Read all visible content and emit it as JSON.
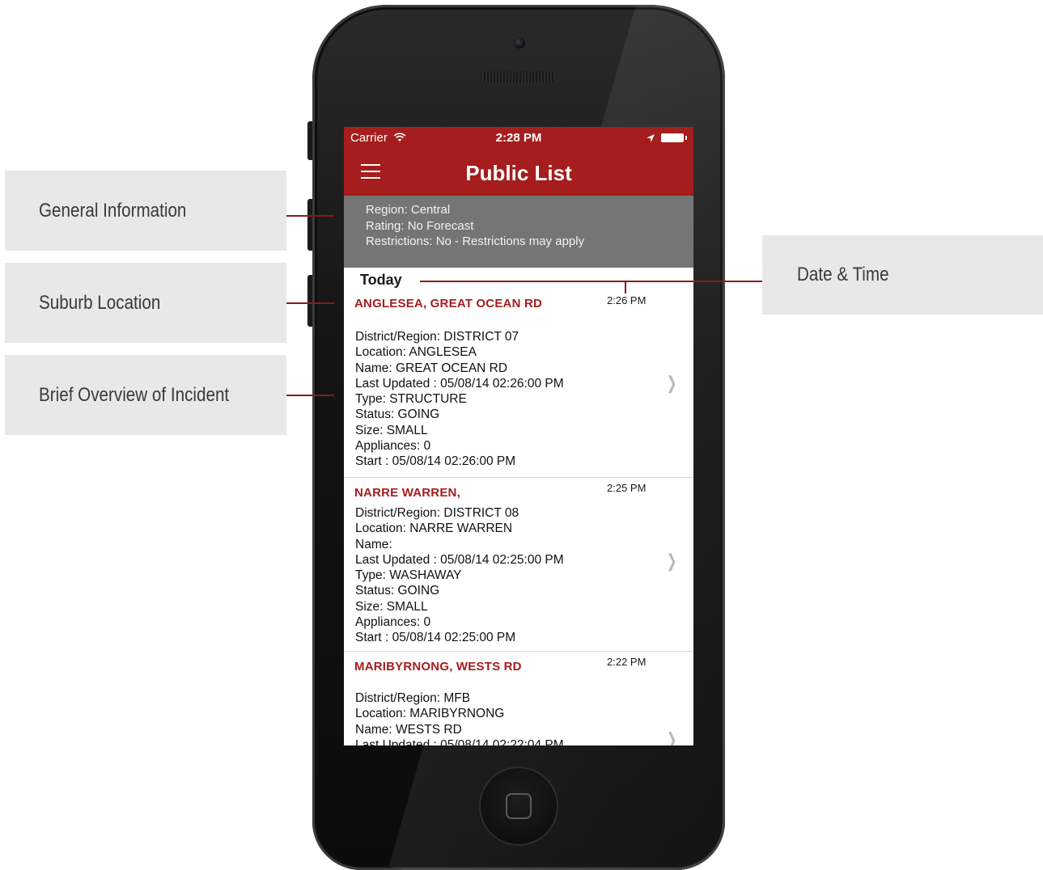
{
  "callouts": {
    "general_info": "General Information",
    "suburb_location": "Suburb Location",
    "brief_overview": "Brief Overview of Incident",
    "date_time": "Date & Time"
  },
  "status_bar": {
    "carrier": "Carrier",
    "time": "2:28 PM"
  },
  "nav": {
    "title": "Public List"
  },
  "info": {
    "region": "Region: Central",
    "rating": "Rating:  No Forecast",
    "restrictions": "Restrictions:  No - Restrictions may apply"
  },
  "section": {
    "label": "Today"
  },
  "incidents": [
    {
      "place": "ANGLESEA, GREAT OCEAN RD",
      "time": "2:26 PM",
      "lines": [
        "District/Region: DISTRICT 07",
        "Location: ANGLESEA",
        "Name: GREAT OCEAN RD",
        "Last Updated : 05/08/14 02:26:00 PM",
        "Type: STRUCTURE",
        "Status: GOING",
        "Size: SMALL",
        "Appliances: 0",
        "Start : 05/08/14 02:26:00 PM"
      ]
    },
    {
      "place": "NARRE WARREN,",
      "time": "2:25 PM",
      "lines": [
        "District/Region: DISTRICT 08",
        "Location: NARRE WARREN",
        "Name:",
        "Last Updated : 05/08/14 02:25:00 PM",
        "Type: WASHAWAY",
        "Status: GOING",
        "Size: SMALL",
        "Appliances: 0",
        "Start : 05/08/14 02:25:00 PM"
      ]
    },
    {
      "place": "MARIBYRNONG, WESTS RD",
      "time": "2:22 PM",
      "lines": [
        "District/Region: MFB",
        "Location: MARIBYRNONG",
        "Name: WESTS RD",
        "Last Updated : 05/08/14 02:22:04 PM"
      ]
    }
  ],
  "colors": {
    "brand_red": "#a51d1d",
    "info_gray": "#757575",
    "callout_bg": "#e8e8e8"
  },
  "icons": {
    "menu": "hamburger-menu-icon",
    "wifi": "wifi-icon",
    "location": "location-arrow-icon",
    "battery": "battery-icon",
    "chevron": "chevron-right-icon"
  }
}
